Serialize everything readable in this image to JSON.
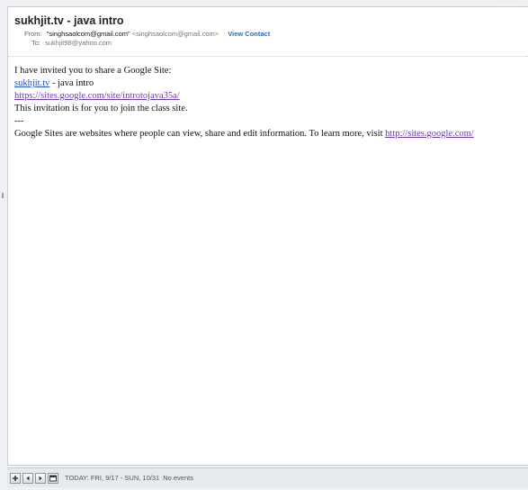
{
  "email": {
    "subject": "sukhjit.tv - java intro",
    "from_label": "From:",
    "from_name": "\"singhsaolcom@gmail.com\"",
    "from_address": "<singhsaolcom@gmail.com>",
    "view_contact": "View Contact",
    "to_label": "To:",
    "to_address": "sukhjit98@yahoo.com"
  },
  "body": {
    "line1": "I have invited you to share a Google Site:",
    "site_link": "sukhjit.tv",
    "site_suffix": " - java intro",
    "site_url": "https://sites.google.com/site/introtojava35a/",
    "line4": "This invitation is for you to join the class site.",
    "separator": "---",
    "footer_text": "Google Sites are websites where people can view, share and edit information. To learn more, visit ",
    "footer_link": "http://sites.google.com/"
  },
  "statusbar": {
    "icons": [
      "add-icon",
      "prev-arrow-icon",
      "next-arrow-icon",
      "calendar-icon"
    ],
    "date_range": "TODAY: FRI, 9/17 - SUN, 10/31",
    "events": "No events"
  }
}
